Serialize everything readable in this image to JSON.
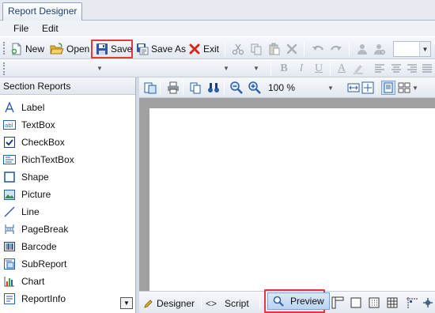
{
  "window": {
    "tab_title": "Report Designer"
  },
  "menubar": {
    "items": [
      "File",
      "Edit"
    ]
  },
  "toolbar": {
    "new_label": "New",
    "open_label": "Open",
    "save_label": "Save",
    "save_as_label": "Save As",
    "exit_label": "Exit",
    "highlight_color": "#e23a3a",
    "style_combo_value": ""
  },
  "format_toolbar": {
    "font_combo_value": "",
    "size_combo_value": "",
    "bold": "B",
    "italic": "I",
    "underline": "U",
    "font_color": "A"
  },
  "toolbox": {
    "title": "Section Reports",
    "items": [
      {
        "label": "Label",
        "icon": "label-icon"
      },
      {
        "label": "TextBox",
        "icon": "textbox-icon"
      },
      {
        "label": "CheckBox",
        "icon": "checkbox-icon"
      },
      {
        "label": "RichTextBox",
        "icon": "richtextbox-icon"
      },
      {
        "label": "Shape",
        "icon": "shape-icon"
      },
      {
        "label": "Picture",
        "icon": "picture-icon"
      },
      {
        "label": "Line",
        "icon": "line-icon"
      },
      {
        "label": "PageBreak",
        "icon": "pagebreak-icon"
      },
      {
        "label": "Barcode",
        "icon": "barcode-icon"
      },
      {
        "label": "SubReport",
        "icon": "subreport-icon"
      },
      {
        "label": "Chart",
        "icon": "chart-icon"
      },
      {
        "label": "ReportInfo",
        "icon": "reportinfo-icon"
      }
    ]
  },
  "designer_toolbar": {
    "zoom_value": "100 %"
  },
  "bottom_tabs": {
    "designer_label": "Designer",
    "script_label": "Script",
    "preview_label": "Preview"
  }
}
